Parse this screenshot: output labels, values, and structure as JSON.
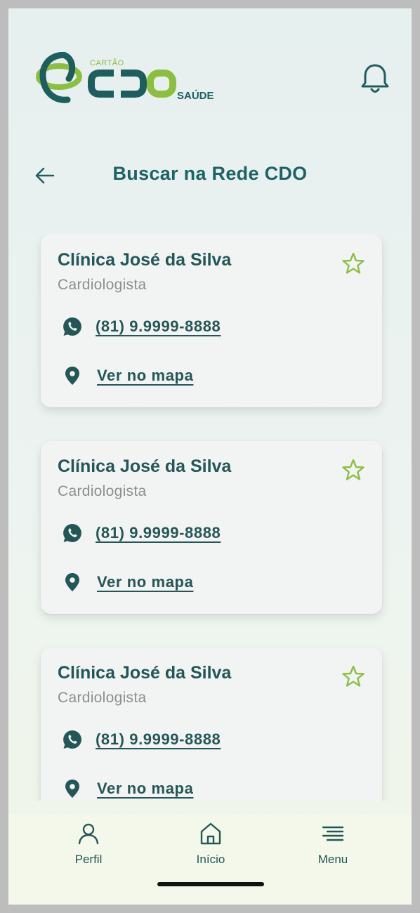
{
  "brand": {
    "small_text": "CARTÃO",
    "main_text": "CDO",
    "suffix_text": "SAÚDE",
    "colors": {
      "dark": "#1d5f5f",
      "green": "#8dbf3f"
    }
  },
  "header": {
    "notification_icon": "bell-icon"
  },
  "page": {
    "title": "Buscar na Rede CDO",
    "back_icon": "arrow-left-icon"
  },
  "results": [
    {
      "name": "Clínica José da Silva",
      "specialty": "Cardiologista",
      "phone": "(81) 9.9999-8888",
      "map_label": "Ver no mapa"
    },
    {
      "name": "Clínica José da Silva",
      "specialty": "Cardiologista",
      "phone": "(81) 9.9999-8888",
      "map_label": "Ver no mapa"
    },
    {
      "name": "Clínica José da Silva",
      "specialty": "Cardiologista",
      "phone": "(81) 9.9999-8888",
      "map_label": "Ver no mapa"
    }
  ],
  "tabbar": {
    "items": [
      {
        "label": "Perfil",
        "icon": "user-icon"
      },
      {
        "label": "Início",
        "icon": "home-icon"
      },
      {
        "label": "Menu",
        "icon": "menu-icon"
      }
    ]
  },
  "colors": {
    "primary": "#235757",
    "accent": "#8dbf3f",
    "muted": "#8a8f8f"
  }
}
